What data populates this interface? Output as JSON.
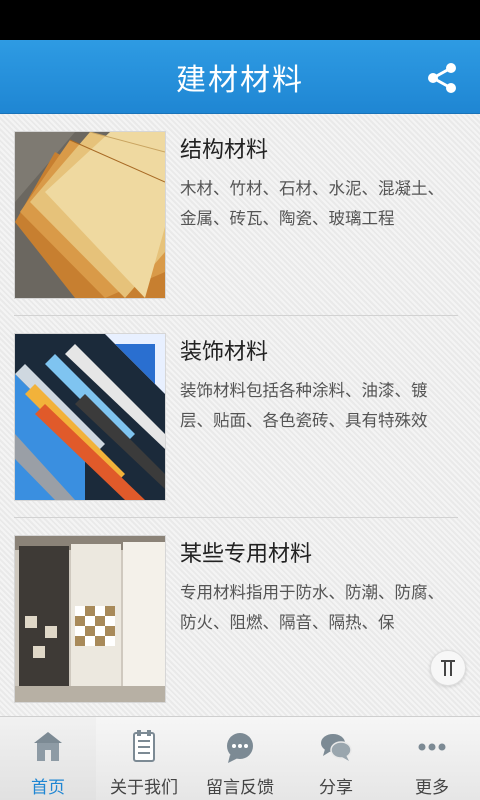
{
  "header": {
    "title": "建材材料",
    "share_icon": "share-icon"
  },
  "items": [
    {
      "title": "结构材料",
      "desc": "木材、竹材、石材、水泥、混凝土、金属、砖瓦、陶瓷、玻璃工程",
      "image": "wood-planks-image"
    },
    {
      "title": "装饰材料",
      "desc": "装饰材料包括各种涂料、油漆、镀层、贴面、各色瓷砖、具有特殊效",
      "image": "decorative-frames-image"
    },
    {
      "title": "某些专用材料",
      "desc": "专用材料指用于防水、防潮、防腐、防火、阻燃、隔音、隔热、保",
      "image": "tile-display-image"
    }
  ],
  "back_to_top": {
    "icon": "back-to-top-icon"
  },
  "tabs": [
    {
      "label": "首页",
      "icon": "home-icon",
      "active": true
    },
    {
      "label": "关于我们",
      "icon": "document-icon",
      "active": false
    },
    {
      "label": "留言反馈",
      "icon": "chat-bubble-icon",
      "active": false
    },
    {
      "label": "分享",
      "icon": "chat-bubbles-icon",
      "active": false
    },
    {
      "label": "更多",
      "icon": "more-dots-icon",
      "active": false
    }
  ],
  "colors": {
    "header_blue": "#1f86d3",
    "active_tab": "#1f86d3"
  }
}
